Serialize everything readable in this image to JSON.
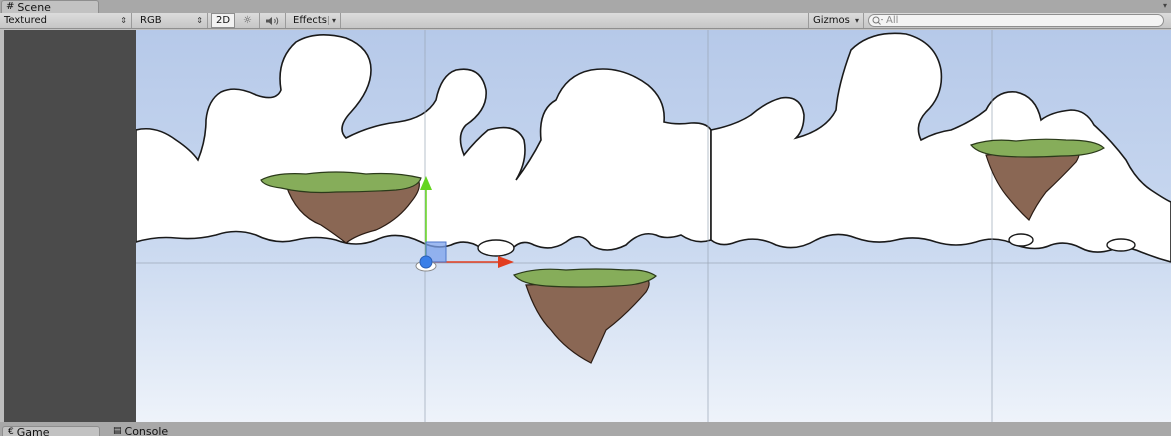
{
  "window": {
    "scene_tab_label": "Scene",
    "scene_tab_icon": "scene-grid-icon",
    "panel_menu_icon": "dropdown-menu-icon"
  },
  "toolbar": {
    "draw_mode": "Textured",
    "render_mode": "RGB",
    "mode_2d": "2D",
    "lighting_icon": "sun-icon",
    "audio_icon": "speaker-icon",
    "effects": "Effects",
    "gizmos": "Gizmos",
    "search_placeholder": "All",
    "search_icon": "search-icon"
  },
  "scene": {
    "sky_colors": {
      "top": "#b6c9e9",
      "bottom": "#eef3fa"
    },
    "island_grass_color": "#86ad5a",
    "island_rock_color": "#8a6754",
    "gizmo": {
      "x_axis_color": "#e23d1f",
      "y_axis_color": "#64d51f",
      "center_color": "#3a7fe8"
    }
  },
  "bottom_tabs": [
    {
      "label": "Game",
      "icon": "game-controller-icon"
    },
    {
      "label": "Console",
      "icon": "console-icon"
    }
  ]
}
